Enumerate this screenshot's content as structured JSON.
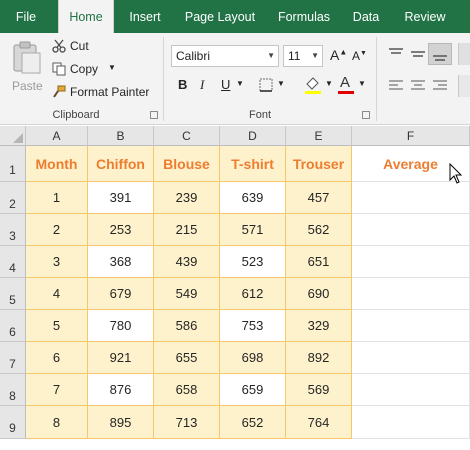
{
  "tabs": [
    "File",
    "Home",
    "Insert",
    "Page Layout",
    "Formulas",
    "Data",
    "Review"
  ],
  "active_tab": "Home",
  "ribbon": {
    "clipboard": {
      "paste_label": "Paste",
      "cut_label": "Cut",
      "copy_label": "Copy",
      "format_painter_label": "Format Painter",
      "group_label": "Clipboard"
    },
    "font": {
      "font_name": "Calibri",
      "font_size": "11",
      "group_label": "Font",
      "bold": "B",
      "italic": "I",
      "underline": "U"
    }
  },
  "sheet": {
    "columns": [
      "A",
      "B",
      "C",
      "D",
      "E",
      "F"
    ],
    "rows": [
      "1",
      "2",
      "3",
      "4",
      "5",
      "6",
      "7",
      "8",
      "9"
    ],
    "header": [
      "Month",
      "Chiffon",
      "Blouse",
      "T-shirt",
      "Trouser",
      "Average"
    ],
    "data": [
      [
        "1",
        "391",
        "239",
        "639",
        "457"
      ],
      [
        "2",
        "253",
        "215",
        "571",
        "562"
      ],
      [
        "3",
        "368",
        "439",
        "523",
        "651"
      ],
      [
        "4",
        "679",
        "549",
        "612",
        "690"
      ],
      [
        "5",
        "780",
        "586",
        "753",
        "329"
      ],
      [
        "6",
        "921",
        "655",
        "698",
        "892"
      ],
      [
        "7",
        "876",
        "658",
        "659",
        "569"
      ],
      [
        "8",
        "895",
        "713",
        "652",
        "764"
      ]
    ]
  },
  "colors": {
    "accent": "#217346",
    "header_text": "#ed7d31",
    "table_fill": "#fef2cc",
    "table_border": "#f6c86a"
  }
}
